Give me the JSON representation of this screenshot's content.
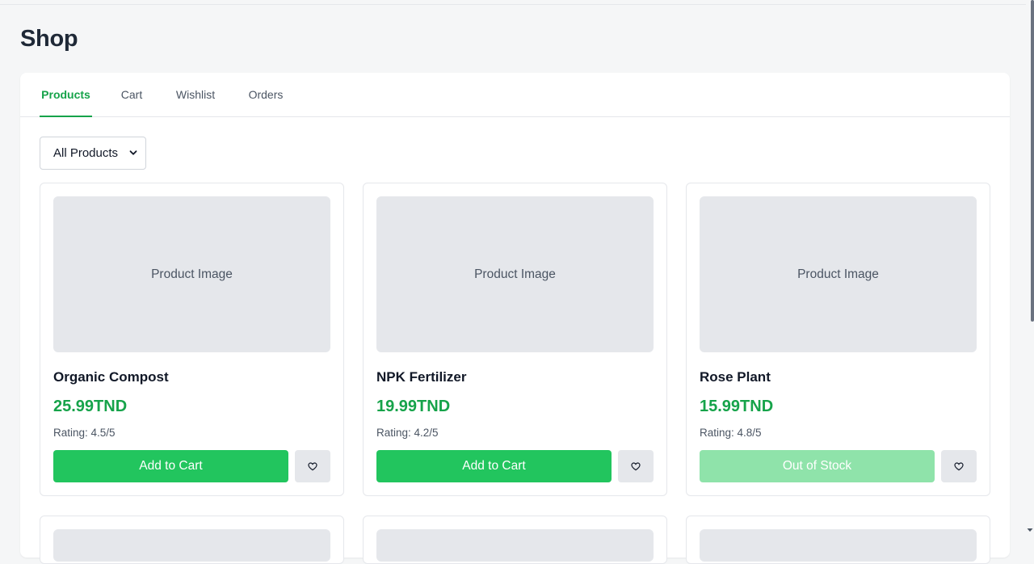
{
  "page": {
    "title": "Shop"
  },
  "tabs": [
    {
      "label": "Products",
      "active": true
    },
    {
      "label": "Cart",
      "active": false
    },
    {
      "label": "Wishlist",
      "active": false
    },
    {
      "label": "Orders",
      "active": false
    }
  ],
  "filter": {
    "selected": "All Products"
  },
  "products": [
    {
      "image_label": "Product Image",
      "name": "Organic Compost",
      "price": "25.99TND",
      "rating": "Rating: 4.5/5",
      "action": "Add to Cart",
      "in_stock": true,
      "wishlist_icon": "heart-icon"
    },
    {
      "image_label": "Product Image",
      "name": "NPK Fertilizer",
      "price": "19.99TND",
      "rating": "Rating: 4.2/5",
      "action": "Add to Cart",
      "in_stock": true,
      "wishlist_icon": "heart-icon"
    },
    {
      "image_label": "Product Image",
      "name": "Rose Plant",
      "price": "15.99TND",
      "rating": "Rating: 4.8/5",
      "action": "Out of Stock",
      "in_stock": false,
      "wishlist_icon": "heart-icon"
    }
  ],
  "colors": {
    "accent": "#16a34a",
    "button": "#22c55e",
    "button_disabled": "#8fe3aa",
    "placeholder": "#e5e7eb"
  }
}
